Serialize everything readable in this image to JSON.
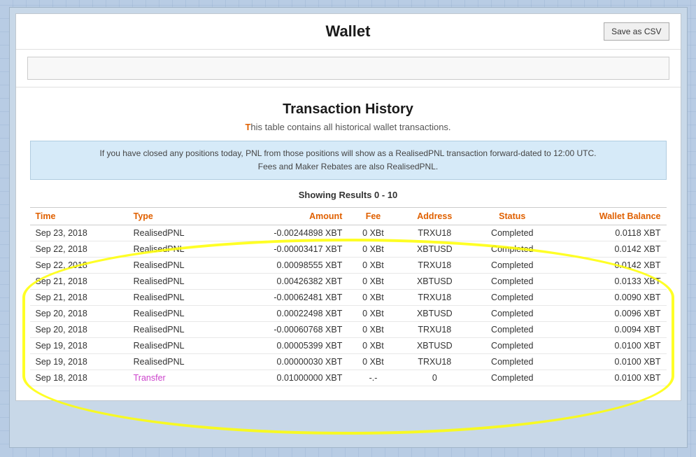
{
  "header": {
    "title": "Wallet",
    "save_csv_label": "Save as CSV"
  },
  "search": {
    "placeholder": "",
    "value": ""
  },
  "transaction_section": {
    "title": "Transaction History",
    "subtitle_prefix": "T",
    "subtitle_rest": "his table contains all historical wallet transactions.",
    "info_line1": "If you have closed any positions today, PNL from those positions will show as a RealisedPNL transaction forward-dated to 12:00 UTC.",
    "info_line2": "Fees and Maker Rebates are also RealisedPNL.",
    "showing_results": "Showing Results 0 - 10"
  },
  "table": {
    "columns": [
      "Time",
      "Type",
      "Amount",
      "Fee",
      "Address",
      "Status",
      "Wallet Balance"
    ],
    "rows": [
      {
        "time": "Sep 23, 2018",
        "type": "RealisedPNL",
        "amount": "-0.00244898 XBT",
        "fee": "0 XBt",
        "address": "TRXU18",
        "status": "Completed",
        "balance": "0.0118 XBT",
        "amount_class": "negative"
      },
      {
        "time": "Sep 22, 2018",
        "type": "RealisedPNL",
        "amount": "-0.00003417 XBT",
        "fee": "0 XBt",
        "address": "XBTUSD",
        "status": "Completed",
        "balance": "0.0142 XBT",
        "amount_class": "negative"
      },
      {
        "time": "Sep 22, 2018",
        "type": "RealisedPNL",
        "amount": "0.00098555 XBT",
        "fee": "0 XBt",
        "address": "TRXU18",
        "status": "Completed",
        "balance": "0.0142 XBT",
        "amount_class": "positive"
      },
      {
        "time": "Sep 21, 2018",
        "type": "RealisedPNL",
        "amount": "0.00426382 XBT",
        "fee": "0 XBt",
        "address": "XBTUSD",
        "status": "Completed",
        "balance": "0.0133 XBT",
        "amount_class": "positive"
      },
      {
        "time": "Sep 21, 2018",
        "type": "RealisedPNL",
        "amount": "-0.00062481 XBT",
        "fee": "0 XBt",
        "address": "TRXU18",
        "status": "Completed",
        "balance": "0.0090 XBT",
        "amount_class": "negative"
      },
      {
        "time": "Sep 20, 2018",
        "type": "RealisedPNL",
        "amount": "0.00022498 XBT",
        "fee": "0 XBt",
        "address": "XBTUSD",
        "status": "Completed",
        "balance": "0.0096 XBT",
        "amount_class": "positive"
      },
      {
        "time": "Sep 20, 2018",
        "type": "RealisedPNL",
        "amount": "-0.00060768 XBT",
        "fee": "0 XBt",
        "address": "TRXU18",
        "status": "Completed",
        "balance": "0.0094 XBT",
        "amount_class": "negative"
      },
      {
        "time": "Sep 19, 2018",
        "type": "RealisedPNL",
        "amount": "0.00005399 XBT",
        "fee": "0 XBt",
        "address": "XBTUSD",
        "status": "Completed",
        "balance": "0.0100 XBT",
        "amount_class": "positive"
      },
      {
        "time": "Sep 19, 2018",
        "type": "RealisedPNL",
        "amount": "0.00000030 XBT",
        "fee": "0 XBt",
        "address": "TRXU18",
        "status": "Completed",
        "balance": "0.0100 XBT",
        "amount_class": "positive"
      },
      {
        "time": "Sep 18, 2018",
        "type": "Transfer",
        "amount": "0.01000000 XBT",
        "fee": "-.-",
        "address": "0",
        "status": "Completed",
        "balance": "0.0100 XBT",
        "amount_class": "transfer"
      }
    ]
  }
}
